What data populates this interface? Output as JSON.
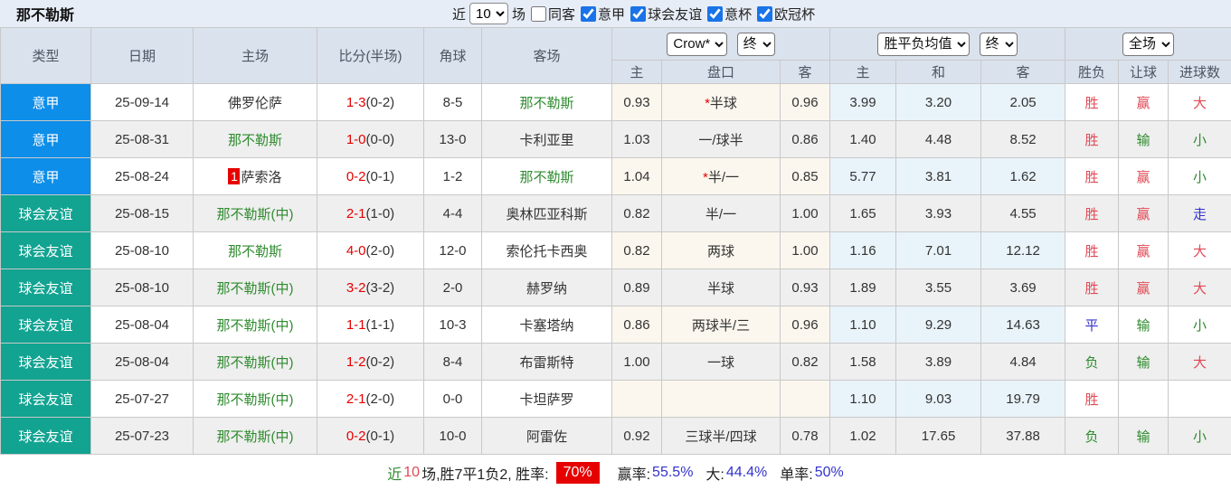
{
  "title": "那不勒斯",
  "topbar": {
    "near_label": "近",
    "near_value": "10",
    "games_label": "场",
    "checkboxes": [
      {
        "label": "同客",
        "checked": false
      },
      {
        "label": "意甲",
        "checked": true
      },
      {
        "label": "球会友谊",
        "checked": true
      },
      {
        "label": "意杯",
        "checked": true
      },
      {
        "label": "欧冠杯",
        "checked": true
      }
    ]
  },
  "header": {
    "type": "类型",
    "date": "日期",
    "home": "主场",
    "score": "比分(半场)",
    "corners": "角球",
    "away": "客场",
    "selects": {
      "bookmaker": "Crow*",
      "stage1": "终",
      "average": "胜平负均值",
      "stage2": "终",
      "scope": "全场"
    },
    "sub": {
      "h": "主",
      "handicap": "盘口",
      "a": "客",
      "w": "主",
      "d": "和",
      "l": "客",
      "result": "胜负",
      "ah": "让球",
      "goals": "进球数"
    }
  },
  "rows": [
    {
      "league": "意甲",
      "league_cls": "serie-a",
      "date": "25-09-14",
      "home": {
        "badge": "",
        "name": "佛罗伦萨",
        "cls": ""
      },
      "score": {
        "ft": "1-3",
        "ht": "(0-2)"
      },
      "corners": "8-5",
      "away": {
        "name": "那不勒斯",
        "cls": "green"
      },
      "odds": {
        "h": "0.93",
        "star": "*",
        "line": "半球",
        "a": "0.96"
      },
      "avg": {
        "w": "3.99",
        "d": "3.20",
        "l": "2.05"
      },
      "result": {
        "text": "胜",
        "cls": "red"
      },
      "ah": {
        "text": "赢",
        "cls": "red"
      },
      "goals": {
        "text": "大",
        "cls": "red"
      }
    },
    {
      "league": "意甲",
      "league_cls": "serie-a",
      "date": "25-08-31",
      "home": {
        "badge": "",
        "name": "那不勒斯",
        "cls": "green"
      },
      "score": {
        "ft": "1-0",
        "ht": "(0-0)"
      },
      "corners": "13-0",
      "away": {
        "name": "卡利亚里",
        "cls": ""
      },
      "odds": {
        "h": "1.03",
        "star": "",
        "line": "一/球半",
        "a": "0.86"
      },
      "avg": {
        "w": "1.40",
        "d": "4.48",
        "l": "8.52"
      },
      "result": {
        "text": "胜",
        "cls": "red"
      },
      "ah": {
        "text": "输",
        "cls": "green"
      },
      "goals": {
        "text": "小",
        "cls": "green"
      }
    },
    {
      "league": "意甲",
      "league_cls": "serie-a",
      "date": "25-08-24",
      "home": {
        "badge": "1",
        "name": "萨索洛",
        "cls": ""
      },
      "score": {
        "ft": "0-2",
        "ht": "(0-1)"
      },
      "corners": "1-2",
      "away": {
        "name": "那不勒斯",
        "cls": "green"
      },
      "odds": {
        "h": "1.04",
        "star": "*",
        "line": "半/一",
        "a": "0.85"
      },
      "avg": {
        "w": "5.77",
        "d": "3.81",
        "l": "1.62"
      },
      "result": {
        "text": "胜",
        "cls": "red"
      },
      "ah": {
        "text": "赢",
        "cls": "red"
      },
      "goals": {
        "text": "小",
        "cls": "green"
      }
    },
    {
      "league": "球会友谊",
      "league_cls": "friendly",
      "date": "25-08-15",
      "home": {
        "badge": "",
        "name": "那不勒斯(中)",
        "cls": "green"
      },
      "score": {
        "ft": "2-1",
        "ht": "(1-0)"
      },
      "corners": "4-4",
      "away": {
        "name": "奥林匹亚科斯",
        "cls": ""
      },
      "odds": {
        "h": "0.82",
        "star": "",
        "line": "半/一",
        "a": "1.00"
      },
      "avg": {
        "w": "1.65",
        "d": "3.93",
        "l": "4.55"
      },
      "result": {
        "text": "胜",
        "cls": "red"
      },
      "ah": {
        "text": "赢",
        "cls": "red"
      },
      "goals": {
        "text": "走",
        "cls": "blue"
      }
    },
    {
      "league": "球会友谊",
      "league_cls": "friendly",
      "date": "25-08-10",
      "home": {
        "badge": "",
        "name": "那不勒斯",
        "cls": "green"
      },
      "score": {
        "ft": "4-0",
        "ht": "(2-0)"
      },
      "corners": "12-0",
      "away": {
        "name": "索伦托卡西奥",
        "cls": ""
      },
      "odds": {
        "h": "0.82",
        "star": "",
        "line": "两球",
        "a": "1.00"
      },
      "avg": {
        "w": "1.16",
        "d": "7.01",
        "l": "12.12"
      },
      "result": {
        "text": "胜",
        "cls": "red"
      },
      "ah": {
        "text": "赢",
        "cls": "red"
      },
      "goals": {
        "text": "大",
        "cls": "red"
      }
    },
    {
      "league": "球会友谊",
      "league_cls": "friendly",
      "date": "25-08-10",
      "home": {
        "badge": "",
        "name": "那不勒斯(中)",
        "cls": "green"
      },
      "score": {
        "ft": "3-2",
        "ht": "(3-2)"
      },
      "corners": "2-0",
      "away": {
        "name": "赫罗纳",
        "cls": ""
      },
      "odds": {
        "h": "0.89",
        "star": "",
        "line": "半球",
        "a": "0.93"
      },
      "avg": {
        "w": "1.89",
        "d": "3.55",
        "l": "3.69"
      },
      "result": {
        "text": "胜",
        "cls": "red"
      },
      "ah": {
        "text": "赢",
        "cls": "red"
      },
      "goals": {
        "text": "大",
        "cls": "red"
      }
    },
    {
      "league": "球会友谊",
      "league_cls": "friendly",
      "date": "25-08-04",
      "home": {
        "badge": "",
        "name": "那不勒斯(中)",
        "cls": "green"
      },
      "score": {
        "ft": "1-1",
        "ht": "(1-1)"
      },
      "corners": "10-3",
      "away": {
        "name": "卡塞塔纳",
        "cls": ""
      },
      "odds": {
        "h": "0.86",
        "star": "",
        "line": "两球半/三",
        "a": "0.96"
      },
      "avg": {
        "w": "1.10",
        "d": "9.29",
        "l": "14.63"
      },
      "result": {
        "text": "平",
        "cls": "blue"
      },
      "ah": {
        "text": "输",
        "cls": "green"
      },
      "goals": {
        "text": "小",
        "cls": "green"
      }
    },
    {
      "league": "球会友谊",
      "league_cls": "friendly",
      "date": "25-08-04",
      "home": {
        "badge": "",
        "name": "那不勒斯(中)",
        "cls": "green"
      },
      "score": {
        "ft": "1-2",
        "ht": "(0-2)"
      },
      "corners": "8-4",
      "away": {
        "name": "布雷斯特",
        "cls": ""
      },
      "odds": {
        "h": "1.00",
        "star": "",
        "line": "一球",
        "a": "0.82"
      },
      "avg": {
        "w": "1.58",
        "d": "3.89",
        "l": "4.84"
      },
      "result": {
        "text": "负",
        "cls": "green"
      },
      "ah": {
        "text": "输",
        "cls": "green"
      },
      "goals": {
        "text": "大",
        "cls": "red"
      }
    },
    {
      "league": "球会友谊",
      "league_cls": "friendly",
      "date": "25-07-27",
      "home": {
        "badge": "",
        "name": "那不勒斯(中)",
        "cls": "green"
      },
      "score": {
        "ft": "2-1",
        "ht": "(2-0)"
      },
      "corners": "0-0",
      "away": {
        "name": "卡坦萨罗",
        "cls": ""
      },
      "odds": {
        "h": "",
        "star": "",
        "line": "",
        "a": ""
      },
      "avg": {
        "w": "1.10",
        "d": "9.03",
        "l": "19.79"
      },
      "result": {
        "text": "胜",
        "cls": "red"
      },
      "ah": {
        "text": "",
        "cls": ""
      },
      "goals": {
        "text": "",
        "cls": ""
      }
    },
    {
      "league": "球会友谊",
      "league_cls": "friendly",
      "date": "25-07-23",
      "home": {
        "badge": "",
        "name": "那不勒斯(中)",
        "cls": "green"
      },
      "score": {
        "ft": "0-2",
        "ht": "(0-1)"
      },
      "corners": "10-0",
      "away": {
        "name": "阿雷佐",
        "cls": ""
      },
      "odds": {
        "h": "0.92",
        "star": "",
        "line": "三球半/四球",
        "a": "0.78"
      },
      "avg": {
        "w": "1.02",
        "d": "17.65",
        "l": "37.88"
      },
      "result": {
        "text": "负",
        "cls": "green"
      },
      "ah": {
        "text": "输",
        "cls": "green"
      },
      "goals": {
        "text": "小",
        "cls": "green"
      }
    }
  ],
  "footer": {
    "near": "近",
    "count": "10",
    "summary": "场,胜7平1负2, 胜率:",
    "win_rate": "70%",
    "ah_label": "赢率:",
    "ah_value": "55.5%",
    "big_label": "大:",
    "big_value": "44.4%",
    "single_label": "单率:",
    "single_value": "50%"
  },
  "colors": {
    "serie_a": "#0d8ee9",
    "friendly": "#12a391",
    "win_red": "#e04a55",
    "lose_green": "#2e8b2e",
    "draw_blue": "#3333cc",
    "score_red": "#e60000",
    "rate_badge_bg": "#e60000",
    "header_bg": "#dae2ed",
    "handicap_col_bg": "#fcf7ee",
    "avg_col_bg": "#e9f3fa"
  }
}
